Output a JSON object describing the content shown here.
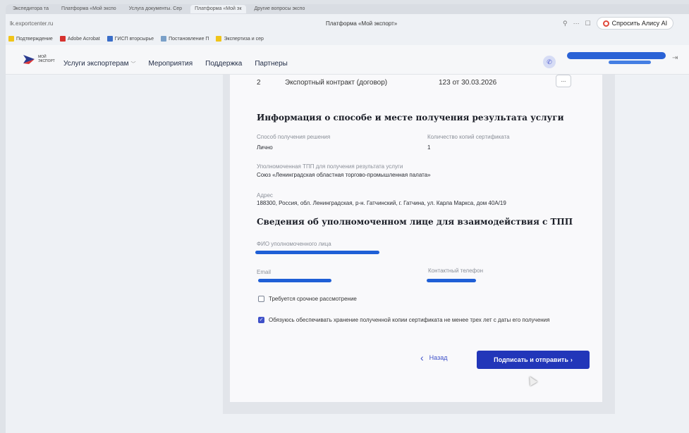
{
  "browser": {
    "tabs": [
      {
        "label": "Экспедитора та"
      },
      {
        "label": "Платформа «Мой экспо"
      },
      {
        "label": "Услуга документы. Сер"
      },
      {
        "label": "Платформа «Мой эк"
      },
      {
        "label": "Другие вопросы экспо"
      }
    ],
    "url": "lk.exportcenter.ru",
    "page_title": "Платформа «Мой экспорт»",
    "alice_label": "Спросить Алису AI",
    "bookmarks": [
      {
        "label": "Подтверждение"
      },
      {
        "label": "Adobe Acrobat"
      },
      {
        "label": "ГИСП вторсырье"
      },
      {
        "label": "Постановление П"
      },
      {
        "label": "Экспертиза и сер"
      }
    ]
  },
  "site": {
    "logo_text_line1": "МОЙ",
    "logo_text_line2": "ЭКСПОРТ",
    "nav": [
      {
        "label": "Услуги экспортерам"
      },
      {
        "label": "Мероприятия"
      },
      {
        "label": "Поддержка"
      },
      {
        "label": "Партнеры"
      }
    ]
  },
  "form": {
    "doc_row": {
      "num": "2",
      "doc": "Экспортный контракт (договор)",
      "ref": "123 от 30.03.2026",
      "more": "..."
    },
    "section1_title": "Информация о способе и месте получения результата услуги",
    "method_label": "Способ получения решения",
    "method_value": "Лично",
    "copies_label": "Количество копий сертификата",
    "copies_value": "1",
    "tpp_label": "Уполномоченная ТПП для получения результата услуги",
    "tpp_value": "Союз «Ленинградская областная торгово-промышленная палата»",
    "address_label": "Адрес",
    "address_value": "188300, Россия, обл. Ленинградская, р-н. Гатчинский, г. Гатчина, ул. Карла Маркса, дом 40А/19",
    "section2_title": "Сведения об уполномоченном лице для взаимодействия с ТПП",
    "fio_label": "ФИО уполномоченного лица",
    "email_label": "Email",
    "phone_label": "Контактный телефон",
    "urgent_label": "Требуется срочное рассмотрение",
    "urgent_checked": false,
    "storage_label": "Обязуюсь обеспечивать хранение полученной копии сертификата не менее трех лет с даты его получения",
    "storage_checked": true,
    "back_label": "Назад",
    "submit_label": "Подписать и отправить"
  },
  "colors": {
    "primary": "#2236b9",
    "redaction": "#1f5fd6"
  }
}
